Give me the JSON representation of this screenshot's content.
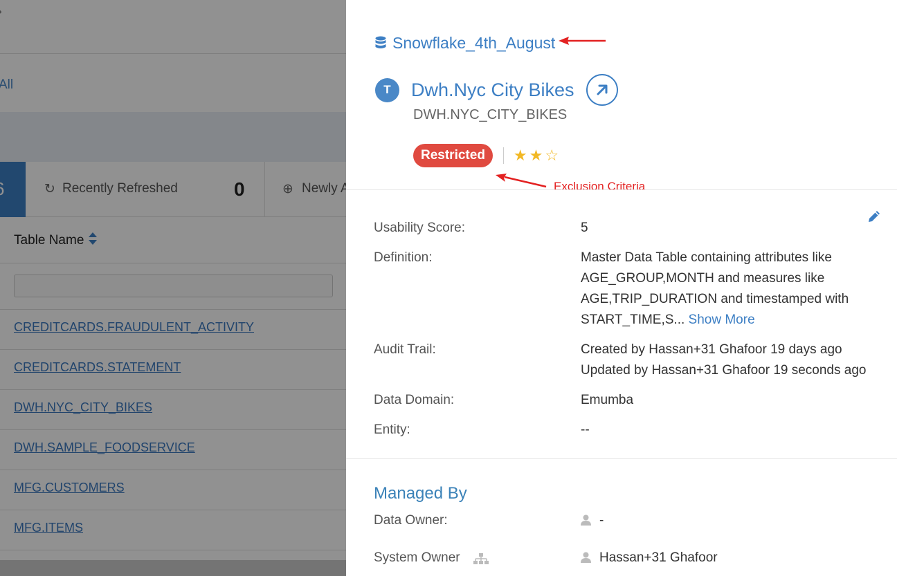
{
  "background": {
    "all_link": "All",
    "tabs": {
      "active_count": "6",
      "recently_refreshed_label": "Recently Refreshed",
      "recently_refreshed_count": "0",
      "newly_added_label": "Newly A"
    },
    "table": {
      "column_header": "Table Name",
      "rows": [
        "CREDITCARDS.FRAUDULENT_ACTIVITY",
        "CREDITCARDS.STATEMENT",
        "DWH.NYC_CITY_BIKES",
        "DWH.SAMPLE_FOODSERVICE",
        "MFG.CUSTOMERS",
        "MFG.ITEMS"
      ]
    }
  },
  "drawer": {
    "source_name": "Snowflake_4th_August",
    "type_badge": "T",
    "title": "Dwh.Nyc City Bikes",
    "technical_name": "DWH.NYC_CITY_BIKES",
    "status_badge": "Restricted",
    "rating": {
      "filled": 2,
      "total": 3
    },
    "annotation": "Exclusion Criteria",
    "properties": {
      "usability_label": "Usability Score:",
      "usability_value": "5",
      "definition_label": "Definition:",
      "definition_line1": "Master Data Table containing attributes like",
      "definition_line2": "AGE_GROUP,MONTH and measures like",
      "definition_line3": "AGE,TRIP_DURATION and timestamped with",
      "definition_line4": "START_TIME,S...",
      "show_more": "Show More",
      "audit_label": "Audit Trail:",
      "audit_created": "Created by Hassan+31 Ghafoor 19 days ago",
      "audit_updated": "Updated by Hassan+31 Ghafoor 19 seconds ago",
      "domain_label": "Data Domain:",
      "domain_value": "Emumba",
      "entity_label": "Entity:",
      "entity_value": "--"
    },
    "managed_by": {
      "title": "Managed By",
      "data_owner_label": "Data Owner:",
      "data_owner_value": "-",
      "system_owner_label": "System Owner",
      "system_owner_value": "Hassan+31 Ghafoor"
    }
  },
  "colors": {
    "accent": "#3d7fc4",
    "restricted": "#e04a40",
    "star": "#f2b824",
    "annotation": "#e32121"
  }
}
